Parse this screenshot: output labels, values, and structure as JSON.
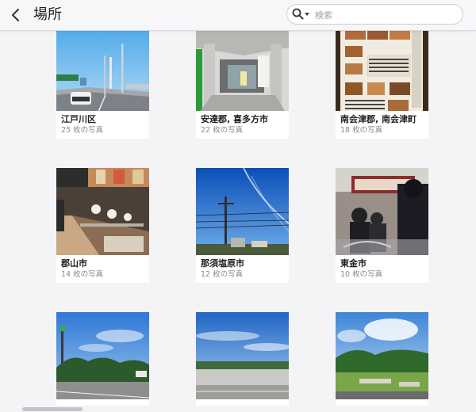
{
  "header": {
    "title": "場所",
    "search_placeholder": "検索"
  },
  "places": [
    {
      "name": "江戸川区",
      "count": "25 枚の写真"
    },
    {
      "name": "安達郡, 喜多方市",
      "count": "22 枚の写真"
    },
    {
      "name": "南会津郡, 南会津町",
      "count": "18 枚の写真"
    },
    {
      "name": "郡山市",
      "count": "14 枚の写真"
    },
    {
      "name": "那須塩原市",
      "count": "12 枚の写真"
    },
    {
      "name": "東金市",
      "count": "10 枚の写真"
    },
    {
      "name": "",
      "count": ""
    },
    {
      "name": "",
      "count": ""
    },
    {
      "name": "",
      "count": ""
    }
  ],
  "colors": {
    "accent_text": "#1f1f1f",
    "secondary_text": "#8c8c92",
    "background": "#f4f4f6"
  }
}
